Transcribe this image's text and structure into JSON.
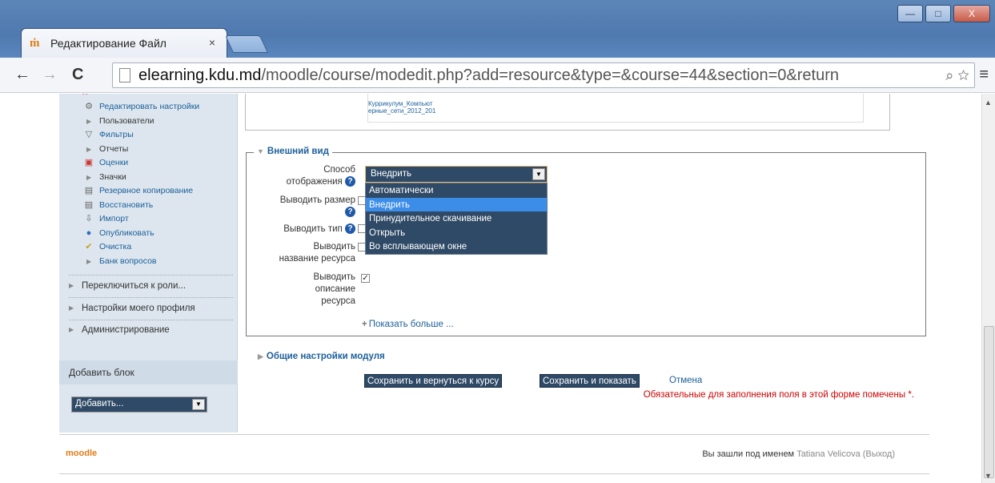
{
  "browser": {
    "tab_icon": "ṁ",
    "tab_title": "Редактирование Файл",
    "tab_close": "×",
    "url_host": "elearning.kdu.md",
    "url_path": "/moodle/course/modedit.php?add=resource&type=&course=44&section=0&return",
    "win_min": "—",
    "win_max": "□",
    "win_close": "X"
  },
  "sidebar": {
    "items": [
      {
        "label": "Редактировать настройки",
        "icon": "gear-icon"
      },
      {
        "label": "Пользователи",
        "icon": "triangle-icon"
      },
      {
        "label": "Фильтры",
        "icon": "filter-icon"
      },
      {
        "label": "Отчеты",
        "icon": "triangle-icon"
      },
      {
        "label": "Оценки",
        "icon": "grades-icon"
      },
      {
        "label": "Значки",
        "icon": "triangle-icon"
      },
      {
        "label": "Резервное копирование",
        "icon": "backup-icon"
      },
      {
        "label": "Восстановить",
        "icon": "restore-icon"
      },
      {
        "label": "Импорт",
        "icon": "import-icon"
      },
      {
        "label": "Опубликовать",
        "icon": "publish-icon"
      },
      {
        "label": "Очистка",
        "icon": "reset-icon"
      },
      {
        "label": "Банк вопросов",
        "icon": "triangle-icon"
      }
    ],
    "switch_role": "Переключиться к роли...",
    "my_profile": "Настройки моего профиля",
    "administration": "Администрирование",
    "add_block_title": "Добавить блок",
    "add_block_select": "Добавить..."
  },
  "file": {
    "name_line1": "Куррикулум_Компьют",
    "name_line2": "ерные_сети_2012_201"
  },
  "appearance": {
    "legend": "Внешний вид",
    "display_label_1": "Способ",
    "display_label_2": "отображения",
    "show_size_label": "Выводить размер",
    "show_type_label": "Выводить тип",
    "show_name_label_1": "Выводить",
    "show_name_label_2": "название ресурса",
    "show_desc_label_1": "Выводить",
    "show_desc_label_2": "описание",
    "show_desc_label_3": "ресурса",
    "show_desc_checked": true,
    "display_selected": "Внедрить",
    "display_options": [
      "Автоматически",
      "Внедрить",
      "Принудительное скачивание",
      "Открыть",
      "Во всплывающем окне"
    ],
    "show_more": "Показать больше ..."
  },
  "general": {
    "legend": "Общие настройки модуля"
  },
  "actions": {
    "save_return": "Сохранить и вернуться к курсу",
    "save_show": "Сохранить и показать",
    "cancel": "Отмена",
    "required_note": "Обязательные для заполнения поля в этой форме помечены",
    "required_mark": "*."
  },
  "footer": {
    "logo": "moodle",
    "logged_in_as": "Вы зашли под именем",
    "user_name": "Tatiana Velicova",
    "logout": "(Выход)"
  }
}
